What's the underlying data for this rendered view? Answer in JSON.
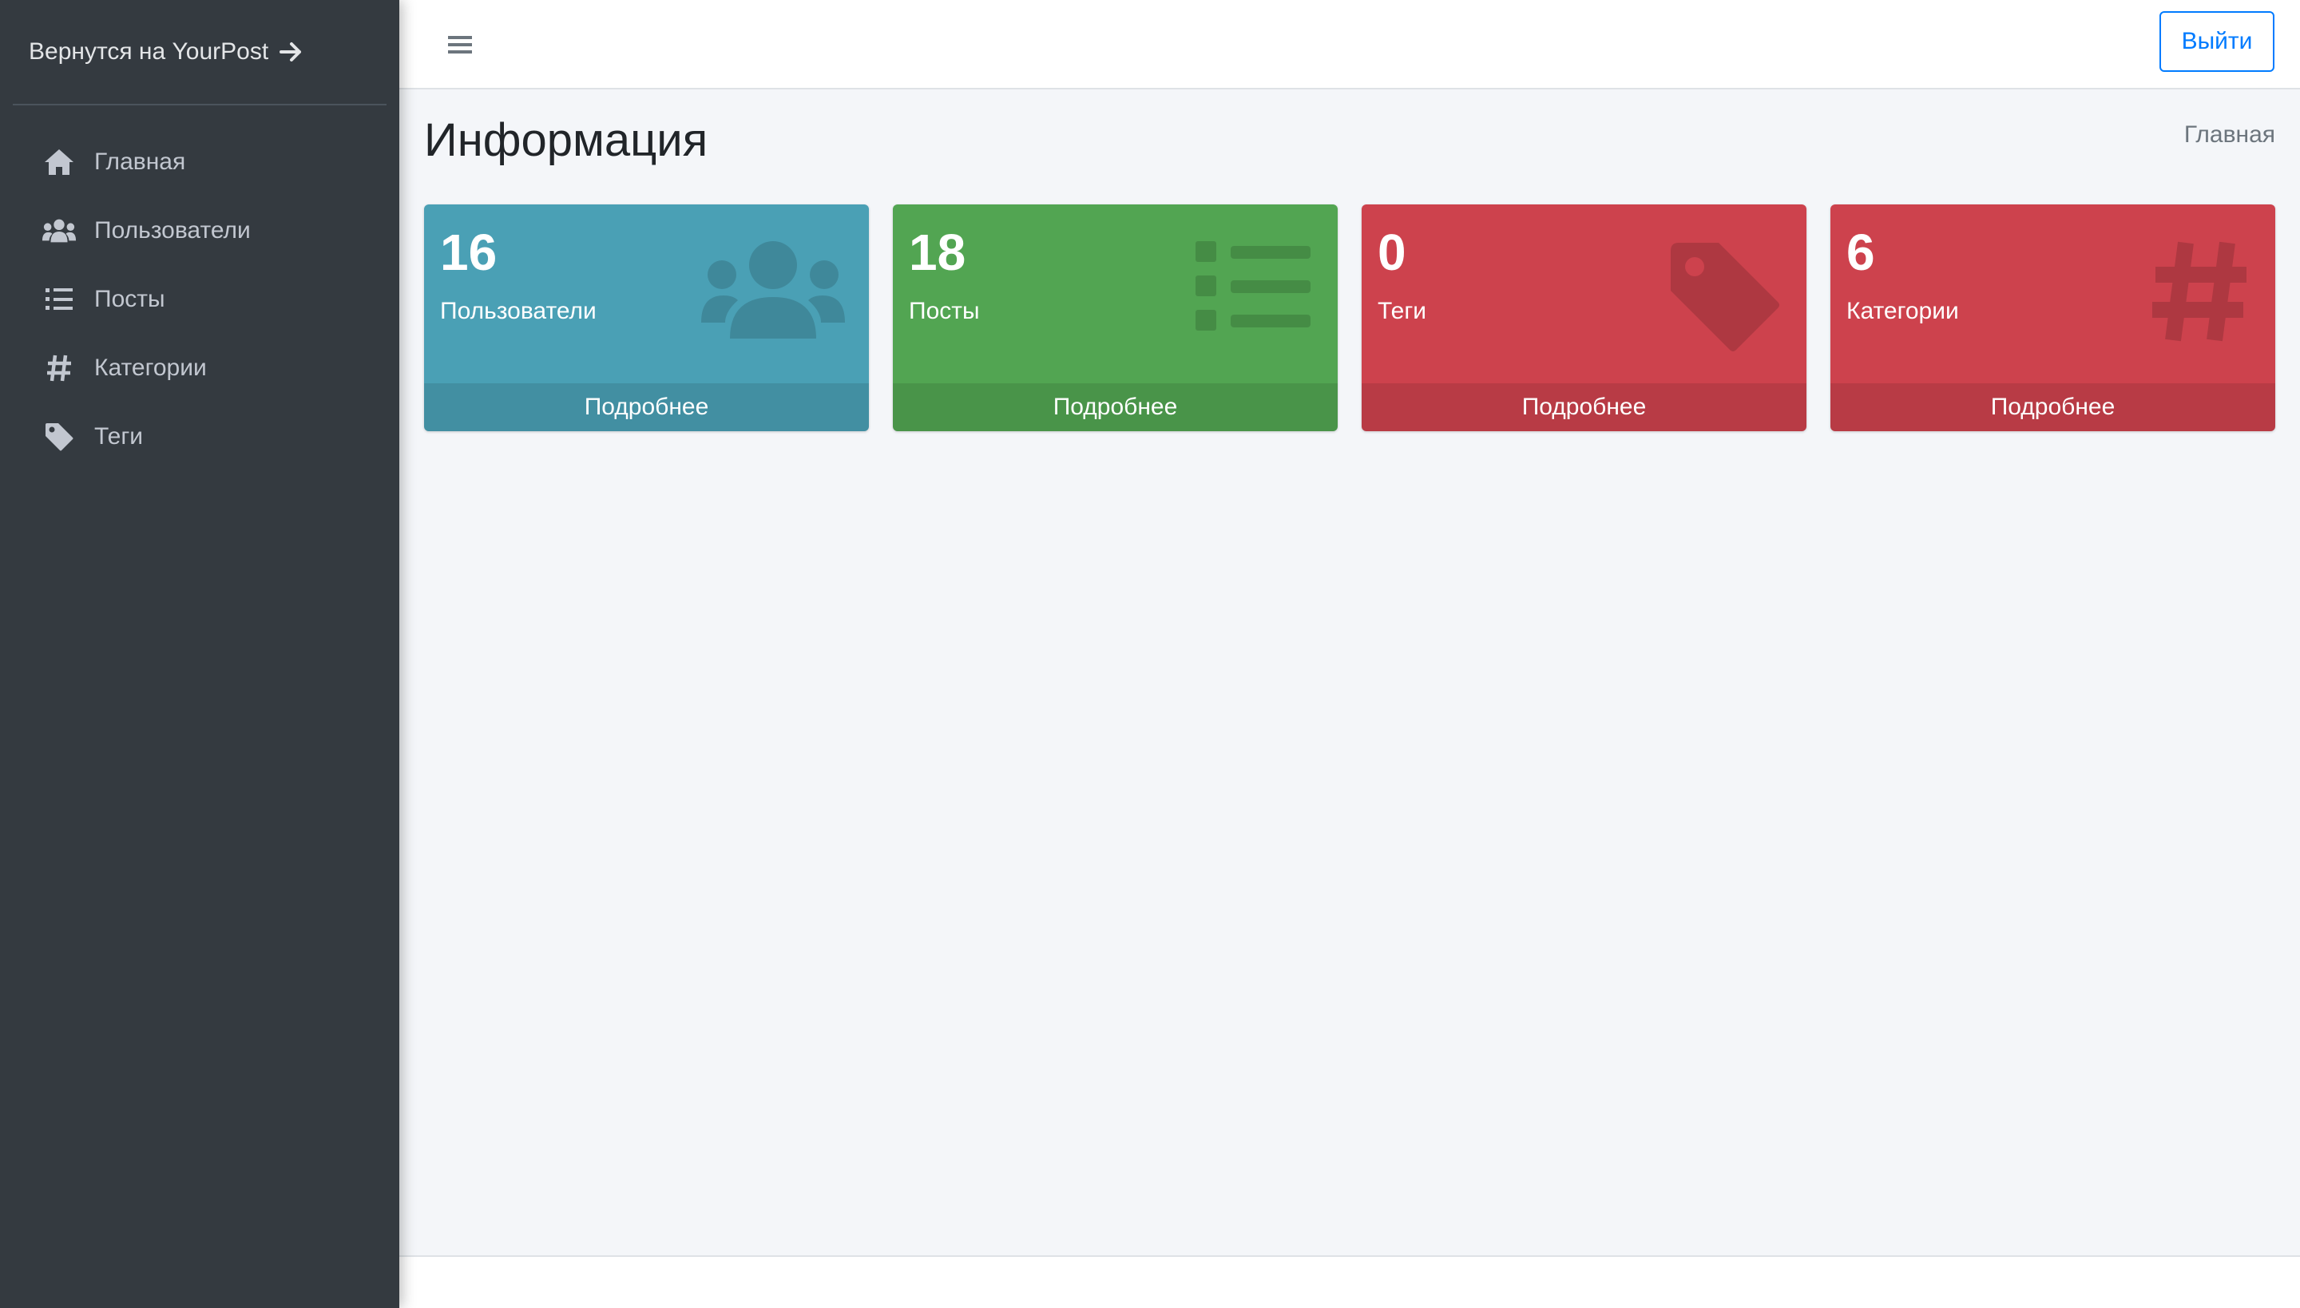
{
  "sidebar": {
    "brand_label": "Вернутся на YourPost",
    "items": [
      {
        "label": "Главная",
        "icon": "home-icon"
      },
      {
        "label": "Пользователи",
        "icon": "users-icon"
      },
      {
        "label": "Посты",
        "icon": "list-icon"
      },
      {
        "label": "Категории",
        "icon": "hashtag-icon"
      },
      {
        "label": "Теги",
        "icon": "tag-icon"
      }
    ]
  },
  "topbar": {
    "menu_icon": "hamburger-icon",
    "logout_label": "Выйти"
  },
  "content": {
    "title": "Информация",
    "breadcrumb": "Главная"
  },
  "cards": [
    {
      "count": "16",
      "label": "Пользователи",
      "more": "Подробнее",
      "icon": "users-icon",
      "color": "#4aa0b5"
    },
    {
      "count": "18",
      "label": "Посты",
      "more": "Подробнее",
      "icon": "list-icon",
      "color": "#52a552"
    },
    {
      "count": "0",
      "label": "Теги",
      "more": "Подробнее",
      "icon": "tag-icon",
      "color": "#cd424d"
    },
    {
      "count": "6",
      "label": "Категории",
      "more": "Подробнее",
      "icon": "hashtag-icon",
      "color": "#cd424d"
    }
  ],
  "colors": {
    "sidebar_bg": "#343a40",
    "primary": "#007bff",
    "info": "#4aa0b5",
    "success": "#52a552",
    "danger": "#cd424d"
  }
}
